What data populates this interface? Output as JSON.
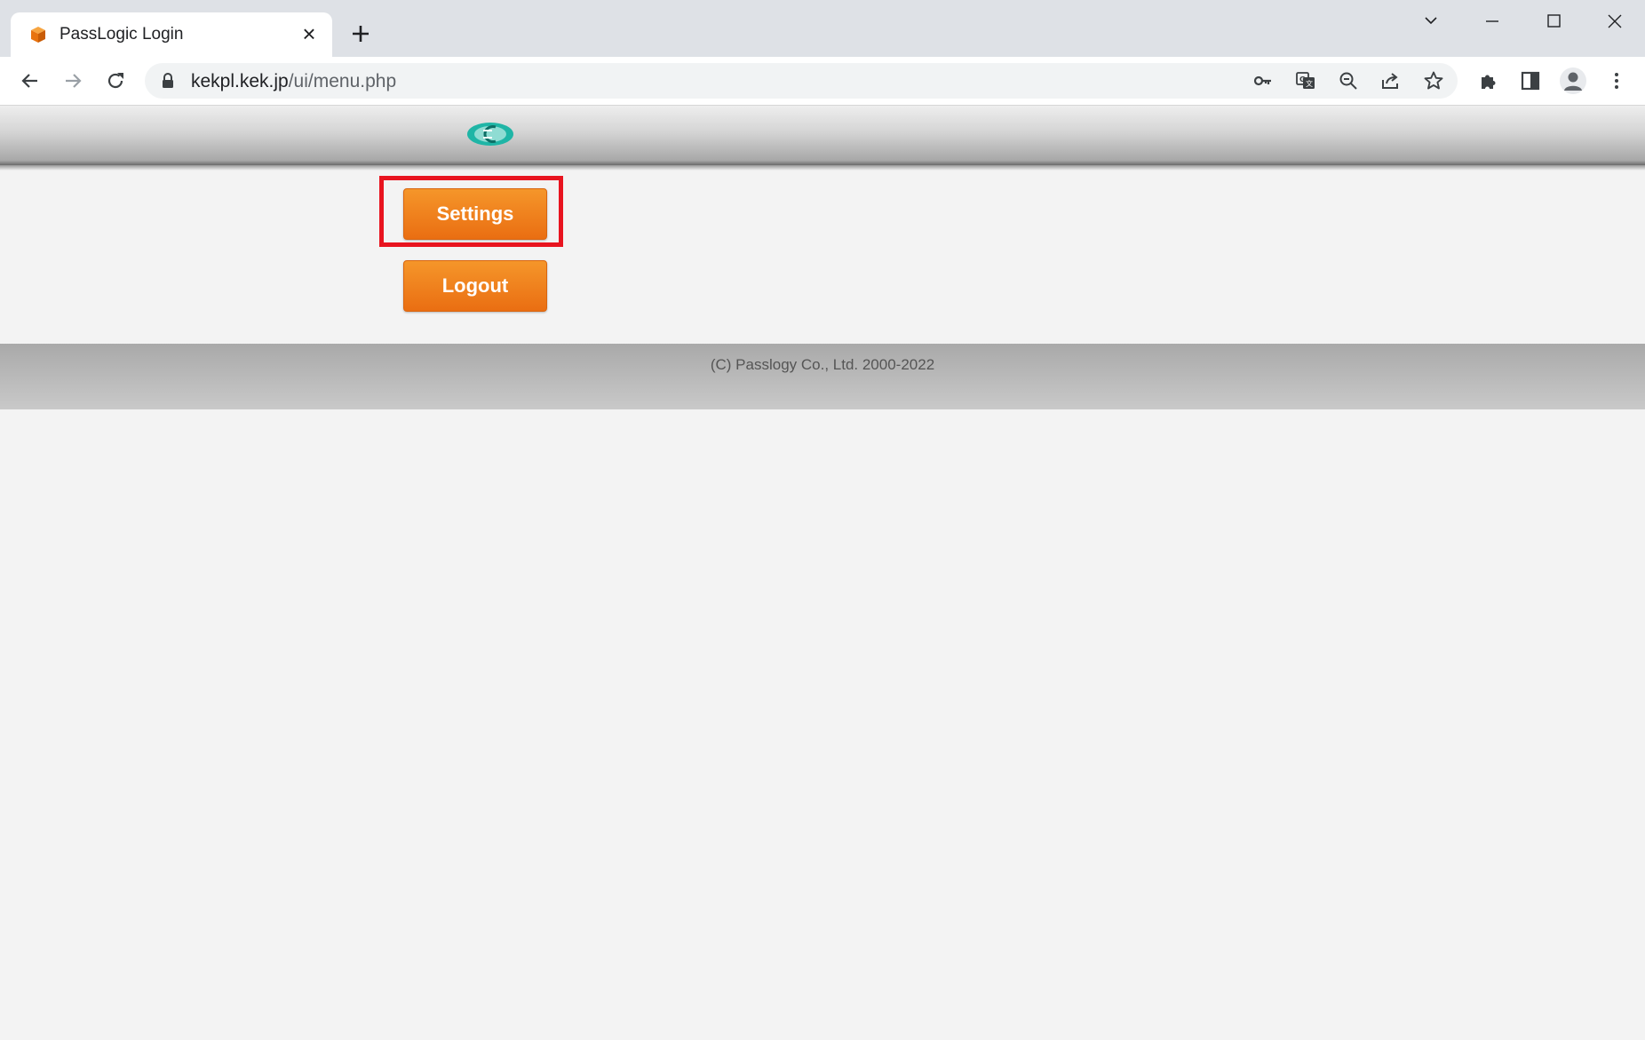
{
  "browser": {
    "tab_title": "PassLogic Login",
    "url_host": "kekpl.kek.jp",
    "url_path": "/ui/menu.php"
  },
  "icons": {
    "tab_favicon": "passlogic-cube-icon",
    "tab_close": "close-icon",
    "new_tab": "plus-icon",
    "back": "arrow-left-icon",
    "forward": "arrow-right-icon",
    "reload": "reload-icon",
    "lock": "lock-icon",
    "password_key": "key-icon",
    "translate": "translate-icon",
    "zoom": "zoom-out-icon",
    "share": "share-icon",
    "bookmark": "star-icon",
    "extensions": "puzzle-icon",
    "side_panel": "side-panel-icon",
    "profile": "profile-icon",
    "menu": "kebab-menu-icon"
  },
  "page": {
    "buttons": {
      "settings": "Settings",
      "logout": "Logout"
    },
    "footer": "(C) Passlogy Co., Ltd. 2000-2022"
  },
  "colors": {
    "button_orange": "#ee7b1a",
    "highlight_red": "#e8141f",
    "logo_teal": "#1fb5a6"
  }
}
